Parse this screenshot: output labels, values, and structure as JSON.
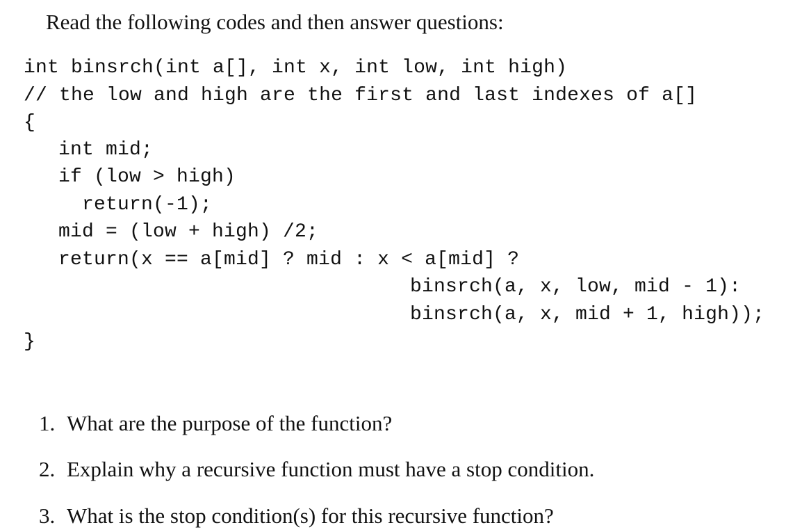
{
  "intro": "Read the following codes and then answer questions:",
  "code": {
    "lines": [
      "int binsrch(int a[], int x, int low, int high)",
      "// the low and high are the first and last indexes of a[]",
      "{",
      "int mid;",
      "if (low > high)",
      "return(-1);",
      "mid = (low + high) /2;",
      "return(x == a[mid] ? mid : x < a[mid] ?",
      "binsrch(a, x, low, mid - 1):",
      "binsrch(a, x, mid + 1, high));",
      "}"
    ]
  },
  "questions": [
    {
      "number": "1.",
      "text": "What are the purpose of the function?"
    },
    {
      "number": "2.",
      "text": "Explain why a recursive function must have a stop condition."
    },
    {
      "number": "3.",
      "text": "What is the stop condition(s) for this recursive function?"
    }
  ]
}
